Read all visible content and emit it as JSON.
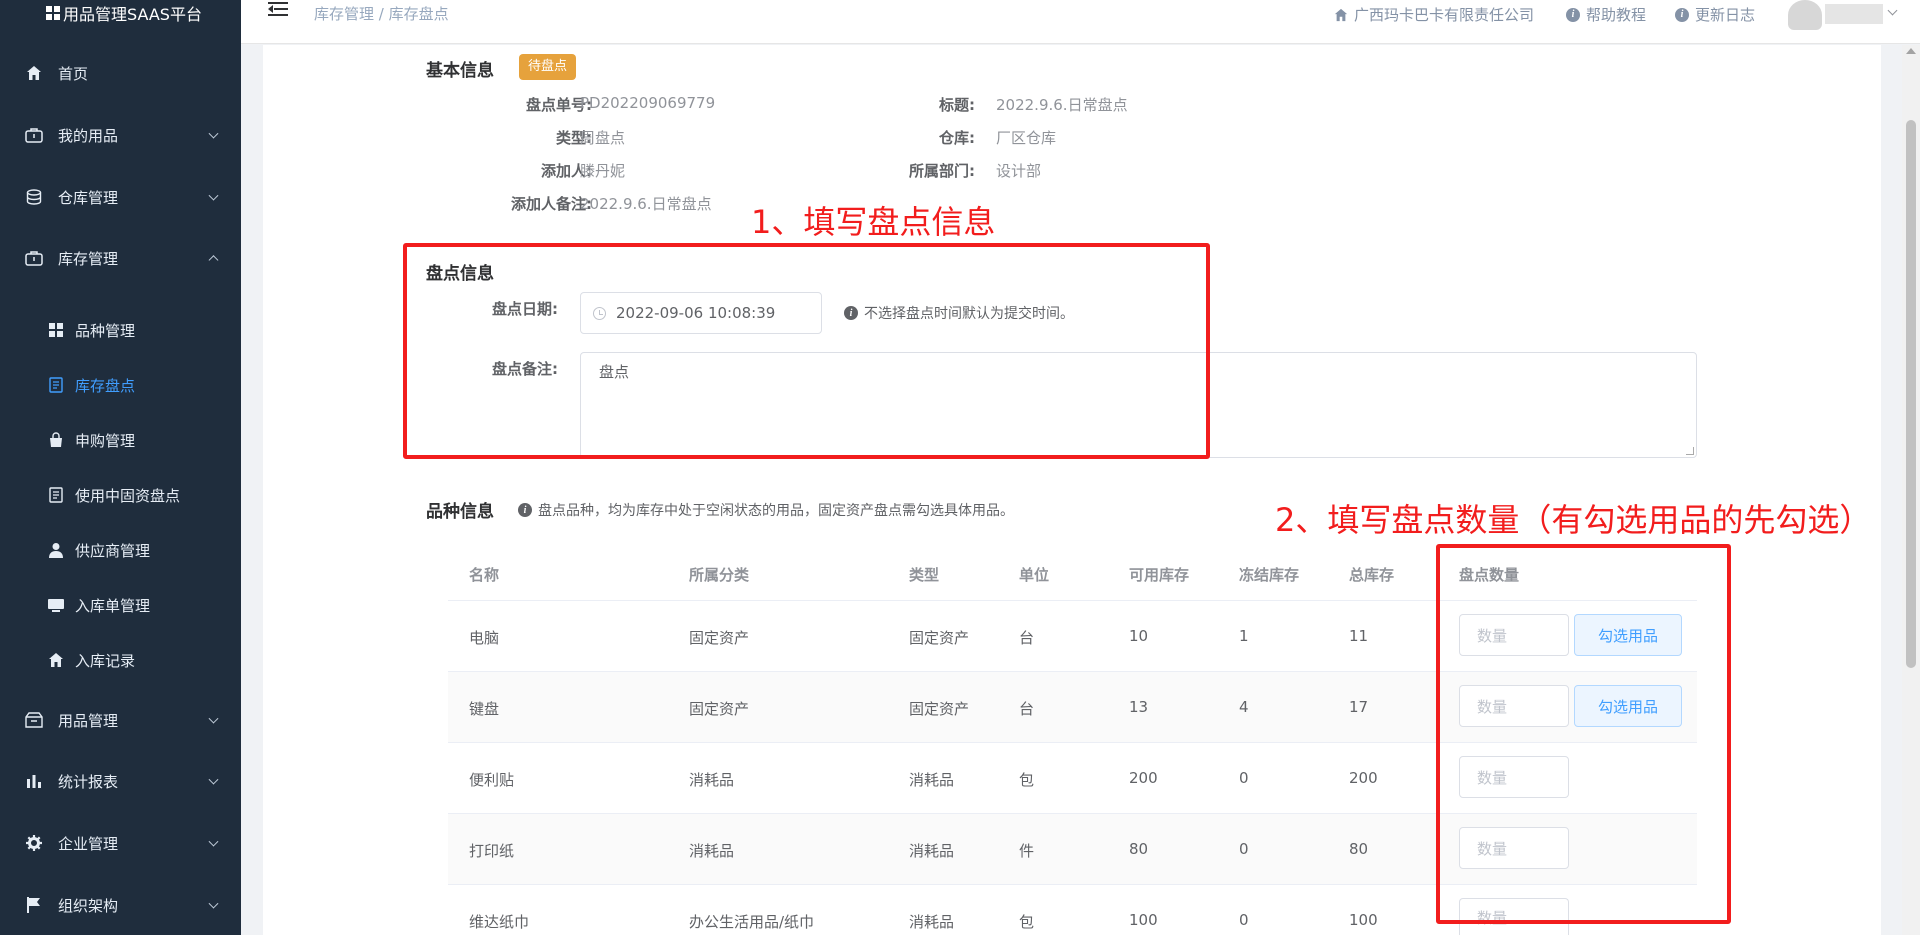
{
  "app": {
    "title": "用品管理SAAS平台"
  },
  "sidebar": {
    "items": [
      {
        "label": "首页",
        "icon": "home-icon"
      },
      {
        "label": "我的用品",
        "icon": "bag-icon"
      },
      {
        "label": "仓库管理",
        "icon": "database-icon"
      },
      {
        "label": "库存管理",
        "icon": "bag-icon"
      },
      {
        "label": "用品管理",
        "icon": "box-icon"
      },
      {
        "label": "统计报表",
        "icon": "bar-chart-icon"
      },
      {
        "label": "企业管理",
        "icon": "gear-icon"
      },
      {
        "label": "组织架构",
        "icon": "flag-icon"
      }
    ],
    "sub_items": [
      {
        "label": "品种管理",
        "icon": "grid-icon"
      },
      {
        "label": "库存盘点",
        "icon": "document-icon",
        "active": true
      },
      {
        "label": "申购管理",
        "icon": "shopping-bag-icon"
      },
      {
        "label": "使用中固资盘点",
        "icon": "document-icon"
      },
      {
        "label": "供应商管理",
        "icon": "user-icon"
      },
      {
        "label": "入库单管理",
        "icon": "monitor-icon"
      },
      {
        "label": "入库记录",
        "icon": "home-icon"
      }
    ]
  },
  "header": {
    "breadcrumb": "库存管理 / 库存盘点",
    "company": "广西玛卡巴卡有限责任公司",
    "help": "帮助教程",
    "changelog": "更新日志"
  },
  "basic_info": {
    "title": "基本信息",
    "status_tag": "待盘点",
    "fields": {
      "order_no_label": "盘点单号:",
      "order_no": "PD202209069779",
      "title_label": "标题:",
      "title": "2022.9.6.日常盘点",
      "type_label": "类型:",
      "type": "周盘点",
      "warehouse_label": "仓库:",
      "warehouse": "厂区仓库",
      "creator_label": "添加人:",
      "creator": "滕丹妮",
      "dept_label": "所属部门:",
      "dept": "设计部",
      "remark_label": "添加人备注:",
      "remark": "2022.9.6.日常盘点"
    }
  },
  "inventory_info": {
    "title": "盘点信息",
    "date_label": "盘点日期:",
    "date_value": "2022-09-06 10:08:39",
    "date_hint": "不选择盘点时间默认为提交时间。",
    "remark_label": "盘点备注:",
    "remark_value": "盘点"
  },
  "variety_info": {
    "title": "品种信息",
    "hint": "盘点品种，均为库存中处于空闲状态的用品，固定资产盘点需勾选具体用品。",
    "columns": [
      "名称",
      "所属分类",
      "类型",
      "单位",
      "可用库存",
      "冻结库存",
      "总库存",
      "盘点数量"
    ],
    "qty_placeholder": "数量",
    "pick_label": "勾选用品",
    "rows": [
      {
        "name": "电脑",
        "category": "固定资产",
        "type": "固定资产",
        "unit": "台",
        "available": "10",
        "frozen": "1",
        "total": "11",
        "pick": true
      },
      {
        "name": "键盘",
        "category": "固定资产",
        "type": "固定资产",
        "unit": "台",
        "available": "13",
        "frozen": "4",
        "total": "17",
        "pick": true
      },
      {
        "name": "便利贴",
        "category": "消耗品",
        "type": "消耗品",
        "unit": "包",
        "available": "200",
        "frozen": "0",
        "total": "200",
        "pick": false
      },
      {
        "name": "打印纸",
        "category": "消耗品",
        "type": "消耗品",
        "unit": "件",
        "available": "80",
        "frozen": "0",
        "total": "80",
        "pick": false
      },
      {
        "name": "维达纸巾",
        "category": "办公生活用品/纸巾",
        "type": "消耗品",
        "unit": "包",
        "available": "100",
        "frozen": "0",
        "total": "100",
        "pick": false
      }
    ]
  },
  "annotations": {
    "step1": "1、填写盘点信息",
    "step2": "2、填写盘点数量（有勾选用品的先勾选）",
    "color": "#f21d1d"
  },
  "colors": {
    "sidebar_bg": "#1f2d3d",
    "accent": "#409eff",
    "warning": "#e6a23c"
  }
}
